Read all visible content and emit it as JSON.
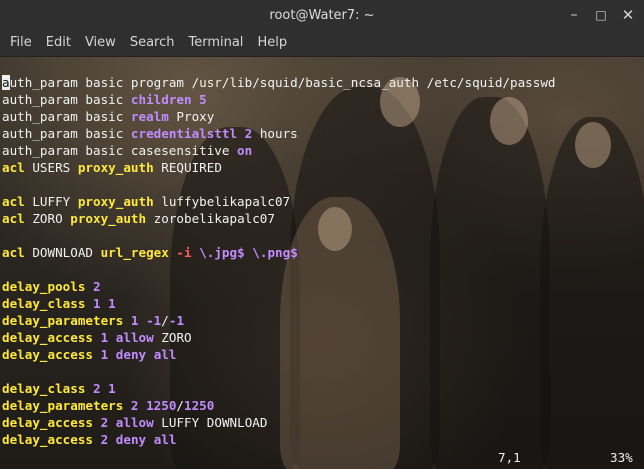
{
  "window": {
    "title": "root@Water7: ~",
    "controls": {
      "minimize": "–",
      "maximize": "□",
      "close": "✕"
    }
  },
  "menu": [
    "File",
    "Edit",
    "View",
    "Search",
    "Terminal",
    "Help"
  ],
  "editor": {
    "cursor_char": "a",
    "lines": [
      [
        [
          "kw",
          "a"
        ],
        [
          "plain",
          "uth_param basic program /usr/lib/squid/basic_ncsa_auth /etc/squid/passwd"
        ]
      ],
      [
        [
          "plain",
          "auth_param basic "
        ],
        [
          "opt",
          "children"
        ],
        [
          "plain",
          " "
        ],
        [
          "num",
          "5"
        ]
      ],
      [
        [
          "plain",
          "auth_param basic "
        ],
        [
          "opt",
          "realm"
        ],
        [
          "plain",
          " Proxy"
        ]
      ],
      [
        [
          "plain",
          "auth_param basic "
        ],
        [
          "opt",
          "credentialsttl"
        ],
        [
          "plain",
          " "
        ],
        [
          "num",
          "2"
        ],
        [
          "plain",
          " hours"
        ]
      ],
      [
        [
          "plain",
          "auth_param basic casesensitive "
        ],
        [
          "opt",
          "on"
        ]
      ],
      [
        [
          "kw",
          "acl"
        ],
        [
          "plain",
          " USERS "
        ],
        [
          "kw",
          "proxy_auth"
        ],
        [
          "plain",
          " REQUIRED"
        ]
      ],
      [],
      [
        [
          "kw",
          "acl"
        ],
        [
          "plain",
          " LUFFY "
        ],
        [
          "kw",
          "proxy_auth"
        ],
        [
          "plain",
          " luffybelikapalc07"
        ]
      ],
      [
        [
          "kw",
          "acl"
        ],
        [
          "plain",
          " ZORO "
        ],
        [
          "kw",
          "proxy_auth"
        ],
        [
          "plain",
          " zorobelikapalc07"
        ]
      ],
      [],
      [
        [
          "kw",
          "acl"
        ],
        [
          "plain",
          " DOWNLOAD "
        ],
        [
          "kw",
          "url_regex"
        ],
        [
          "plain",
          " "
        ],
        [
          "red",
          "-i"
        ],
        [
          "plain",
          " "
        ],
        [
          "opt",
          "\\.jpg$"
        ],
        [
          "plain",
          " "
        ],
        [
          "opt",
          "\\.png$"
        ]
      ],
      [],
      [
        [
          "kw",
          "delay_pools"
        ],
        [
          "plain",
          " "
        ],
        [
          "num",
          "2"
        ]
      ],
      [
        [
          "kw",
          "delay_class"
        ],
        [
          "plain",
          " "
        ],
        [
          "num",
          "1 1"
        ]
      ],
      [
        [
          "kw",
          "delay_parameters"
        ],
        [
          "plain",
          " "
        ],
        [
          "num",
          "1 -1"
        ],
        [
          "plain",
          "/"
        ],
        [
          "num",
          "-1"
        ]
      ],
      [
        [
          "kw",
          "delay_access"
        ],
        [
          "plain",
          " "
        ],
        [
          "num",
          "1"
        ],
        [
          "plain",
          " "
        ],
        [
          "opt",
          "allow"
        ],
        [
          "plain",
          " ZORO"
        ]
      ],
      [
        [
          "kw",
          "delay_access"
        ],
        [
          "plain",
          " "
        ],
        [
          "num",
          "1"
        ],
        [
          "plain",
          " "
        ],
        [
          "opt",
          "deny all"
        ]
      ],
      [],
      [
        [
          "kw",
          "delay_class"
        ],
        [
          "plain",
          " "
        ],
        [
          "num",
          "2 1"
        ]
      ],
      [
        [
          "kw",
          "delay_parameters"
        ],
        [
          "plain",
          " "
        ],
        [
          "num",
          "2 1250"
        ],
        [
          "plain",
          "/"
        ],
        [
          "num",
          "1250"
        ]
      ],
      [
        [
          "kw",
          "delay_access"
        ],
        [
          "plain",
          " "
        ],
        [
          "num",
          "2"
        ],
        [
          "plain",
          " "
        ],
        [
          "opt",
          "allow"
        ],
        [
          "plain",
          " LUFFY DOWNLOAD"
        ]
      ],
      [
        [
          "kw",
          "delay_access"
        ],
        [
          "plain",
          " "
        ],
        [
          "num",
          "2"
        ],
        [
          "plain",
          " "
        ],
        [
          "opt",
          "deny all"
        ]
      ]
    ],
    "status_position": "7,1",
    "status_percent": "33%"
  },
  "colors": {
    "keyword": "#ffe93b",
    "option": "#c28cff",
    "flag": "#ff5a5a",
    "text": "#f2f2f2"
  }
}
